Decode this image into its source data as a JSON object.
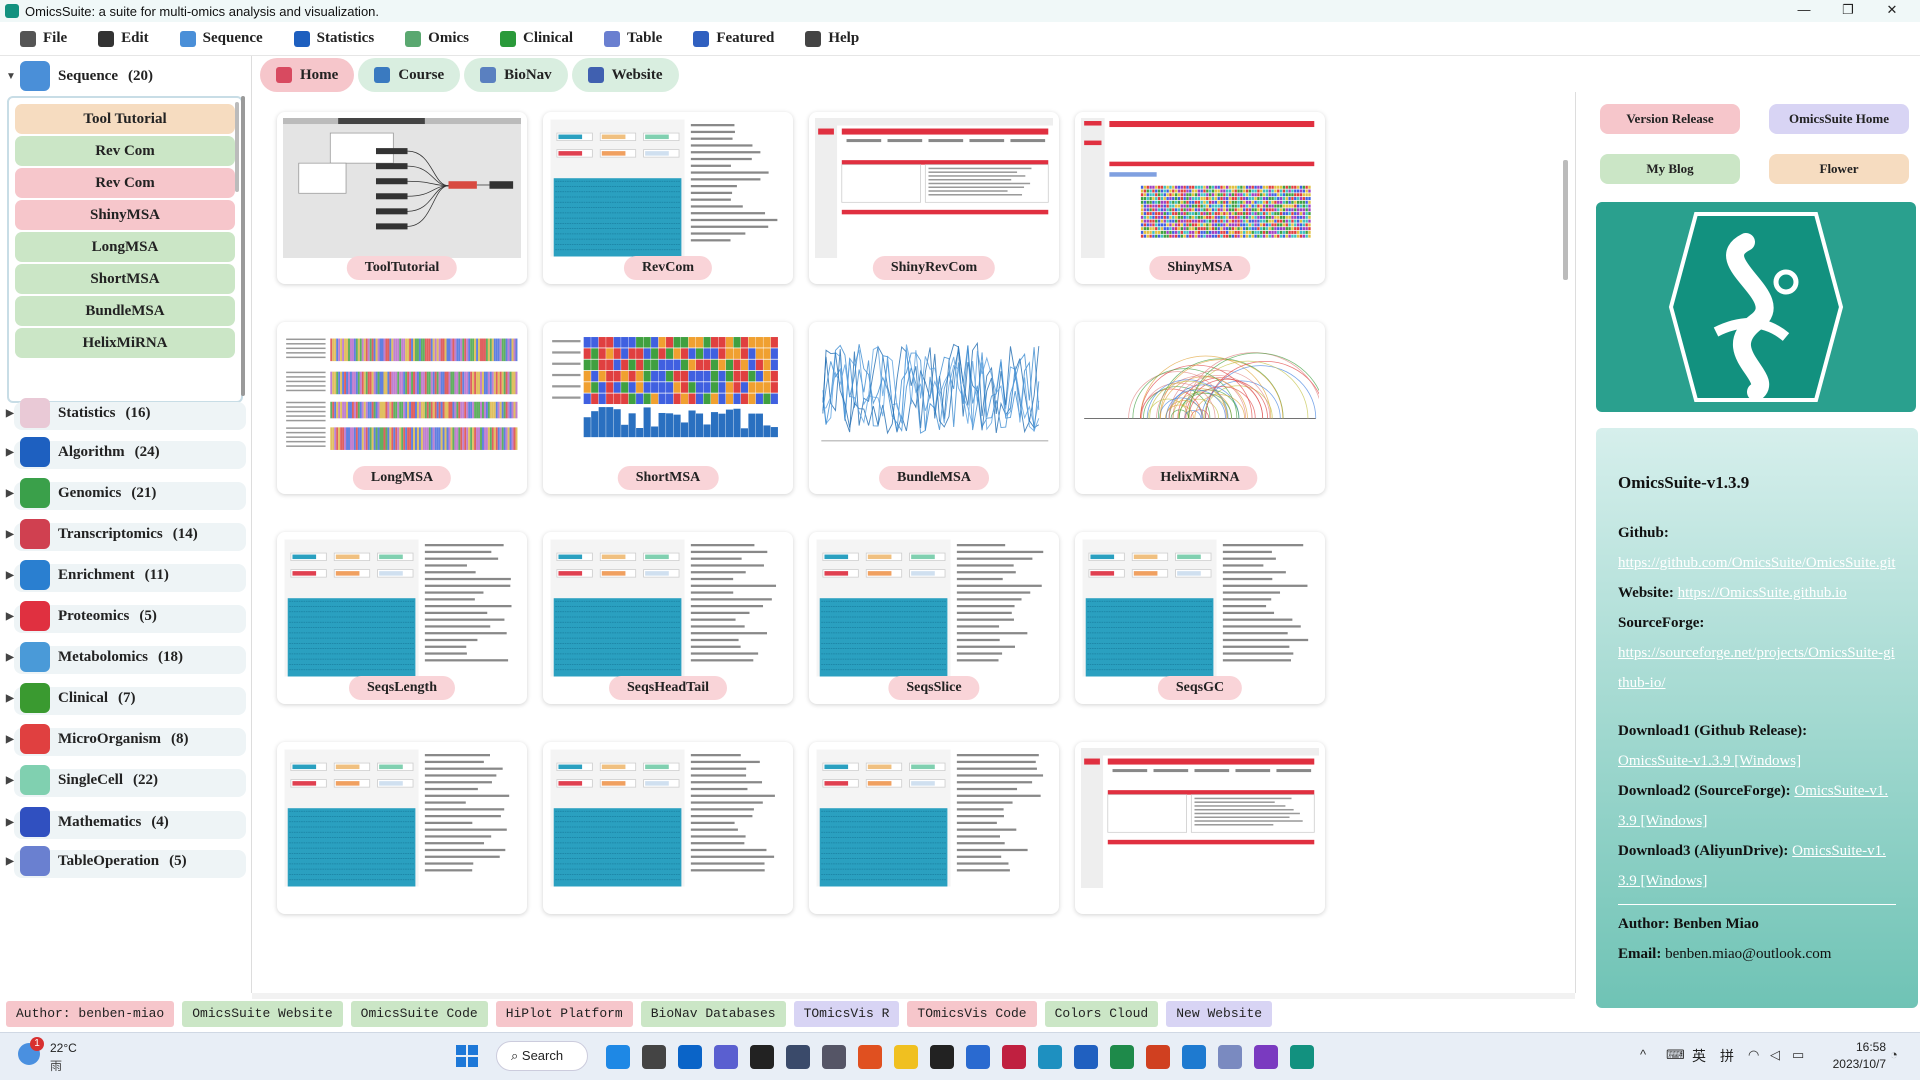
{
  "window": {
    "title": "OmicsSuite: a suite for multi-omics analysis and visualization.",
    "controls": [
      "—",
      "❐",
      "✕"
    ]
  },
  "menubar": [
    {
      "label": "File",
      "icon": "file-icon",
      "color": "#555"
    },
    {
      "label": "Edit",
      "icon": "edit-icon",
      "color": "#333"
    },
    {
      "label": "Sequence",
      "icon": "dna-icon",
      "color": "#4a8fd8"
    },
    {
      "label": "Statistics",
      "icon": "cube-icon",
      "color": "#1e5fbf"
    },
    {
      "label": "Omics",
      "icon": "omics-icon",
      "color": "#5aa870"
    },
    {
      "label": "Clinical",
      "icon": "clinical-icon",
      "color": "#2a9a3a"
    },
    {
      "label": "Table",
      "icon": "table-icon",
      "color": "#6a7fd0"
    },
    {
      "label": "Featured",
      "icon": "featured-icon",
      "color": "#3060c0"
    },
    {
      "label": "Help",
      "icon": "help-icon",
      "color": "#444"
    }
  ],
  "sidebar": {
    "sequence": {
      "label": "Sequence",
      "count": "(20)"
    },
    "tools": [
      {
        "label": "Tool Tutorial",
        "color": "#f6dcc0"
      },
      {
        "label": "Rev Com",
        "color": "#cbe6c6"
      },
      {
        "label": "Rev Com",
        "color": "#f6c6cb"
      },
      {
        "label": "ShinyMSA",
        "color": "#f6c6cb"
      },
      {
        "label": "LongMSA",
        "color": "#cbe6c6"
      },
      {
        "label": "ShortMSA",
        "color": "#cbe6c6"
      },
      {
        "label": "BundleMSA",
        "color": "#cbe6c6"
      },
      {
        "label": "HelixMiRNA",
        "color": "#cbe6c6"
      }
    ],
    "categories": [
      {
        "label": "Statistics",
        "count": "(16)",
        "icon": "statistics-icon",
        "color": "#e9c9d6"
      },
      {
        "label": "Algorithm",
        "count": "(24)",
        "icon": "algorithm-icon",
        "color": "#1e60c0"
      },
      {
        "label": "Genomics",
        "count": "(21)",
        "icon": "genomics-icon",
        "color": "#3aa04a"
      },
      {
        "label": "Transcriptomics",
        "count": "(14)",
        "icon": "transcriptomics-icon",
        "color": "#d04050"
      },
      {
        "label": "Enrichment",
        "count": "(11)",
        "icon": "enrichment-icon",
        "color": "#2a7fd0"
      },
      {
        "label": "Proteomics",
        "count": "(5)",
        "icon": "proteomics-icon",
        "color": "#e03040"
      },
      {
        "label": "Metabolomics",
        "count": "(18)",
        "icon": "metabolomics-icon",
        "color": "#4a9ad8"
      },
      {
        "label": "Clinical",
        "count": "(7)",
        "icon": "clinical-icon",
        "color": "#3a9a30"
      },
      {
        "label": "MicroOrganism",
        "count": "(8)",
        "icon": "microorganism-icon",
        "color": "#e04040"
      },
      {
        "label": "SingleCell",
        "count": "(22)",
        "icon": "singlecell-icon",
        "color": "#80d0b0"
      },
      {
        "label": "Mathematics",
        "count": "(4)",
        "icon": "mathematics-icon",
        "color": "#3050c0"
      },
      {
        "label": "TableOperation",
        "count": "(5)",
        "icon": "table-operation-icon",
        "color": "#6a80d0"
      }
    ]
  },
  "tabs": [
    {
      "label": "Home",
      "icon": "home-icon",
      "color": "#d84a60"
    },
    {
      "label": "Course",
      "icon": "course-icon",
      "color": "#3a7ac0"
    },
    {
      "label": "BioNav",
      "icon": "bionav-icon",
      "color": "#5a80c0"
    },
    {
      "label": "Website",
      "icon": "website-icon",
      "color": "#4060b0"
    }
  ],
  "cards": [
    {
      "label": "ToolTutorial",
      "thumb": "mindmap"
    },
    {
      "label": "RevCom",
      "thumb": "form-blue"
    },
    {
      "label": "ShinyRevCom",
      "thumb": "form-red"
    },
    {
      "label": "ShinyMSA",
      "thumb": "msa-red"
    },
    {
      "label": "LongMSA",
      "thumb": "longmsa"
    },
    {
      "label": "ShortMSA",
      "thumb": "shortmsa"
    },
    {
      "label": "BundleMSA",
      "thumb": "bundle"
    },
    {
      "label": "HelixMiRNA",
      "thumb": "arcs"
    },
    {
      "label": "SeqsLength",
      "thumb": "form-blue"
    },
    {
      "label": "SeqsHeadTail",
      "thumb": "form-blue"
    },
    {
      "label": "SeqsSlice",
      "thumb": "form-blue"
    },
    {
      "label": "SeqsGC",
      "thumb": "form-blue"
    },
    {
      "label": "",
      "thumb": "form-blue"
    },
    {
      "label": "",
      "thumb": "form-blue"
    },
    {
      "label": "",
      "thumb": "form-blue"
    },
    {
      "label": "",
      "thumb": "form-red"
    }
  ],
  "right": {
    "buttons": [
      {
        "label": "Version Release",
        "color": "#f6c6cb"
      },
      {
        "label": "OmicsSuite Home",
        "color": "#d8d4f4"
      },
      {
        "label": "My Blog",
        "color": "#cbe6c6"
      },
      {
        "label": "Flower",
        "color": "#f6dcc0"
      }
    ],
    "version": "OmicsSuite-v1.3.9",
    "github_label": "Github:",
    "github_url": "https://github.com/OmicsSuite/OmicsSuite.git",
    "website_label": "Website:",
    "website_url": "https://OmicsSuite.github.io",
    "sourceforge_label": "SourceForge:",
    "sourceforge_url": "https://sourceforge.net/projects/OmicsSuite-github-io/",
    "download1_label": "Download1 (Github Release):",
    "download1_link": "OmicsSuite-v1.3.9 [Windows]",
    "download2_label": "Download2 (SourceForge):",
    "download2_link": "OmicsSuite-v1.3.9 [Windows]",
    "download3_label": "Download3 (AliyunDrive):",
    "download3_link": "OmicsSuite-v1.3.9 [Windows]",
    "author_label": "Author: Benben Miao",
    "email_label": "Email:",
    "email": "benben.miao@outlook.com"
  },
  "footer": [
    {
      "label": "Author: benben-miao",
      "color": "#f6c6cb"
    },
    {
      "label": "OmicsSuite Website",
      "color": "#cbe6c6"
    },
    {
      "label": "OmicsSuite Code",
      "color": "#cbe6c6"
    },
    {
      "label": "HiPlot Platform",
      "color": "#f6c6cb"
    },
    {
      "label": "BioNav Databases",
      "color": "#cbe6c6"
    },
    {
      "label": "TOmicsVis R",
      "color": "#d8d4f4"
    },
    {
      "label": "TOmicsVis Code",
      "color": "#f6c6cb"
    },
    {
      "label": "Colors Cloud",
      "color": "#cbe6c6"
    },
    {
      "label": "New Website",
      "color": "#d8d4f4"
    }
  ],
  "taskbar": {
    "weather_temp": "22°C",
    "weather_text": "雨",
    "search_label": "Search",
    "ime_1": "英",
    "ime_2": "拼",
    "time": "16:58",
    "date": "2023/10/7",
    "notif_count": "1"
  }
}
